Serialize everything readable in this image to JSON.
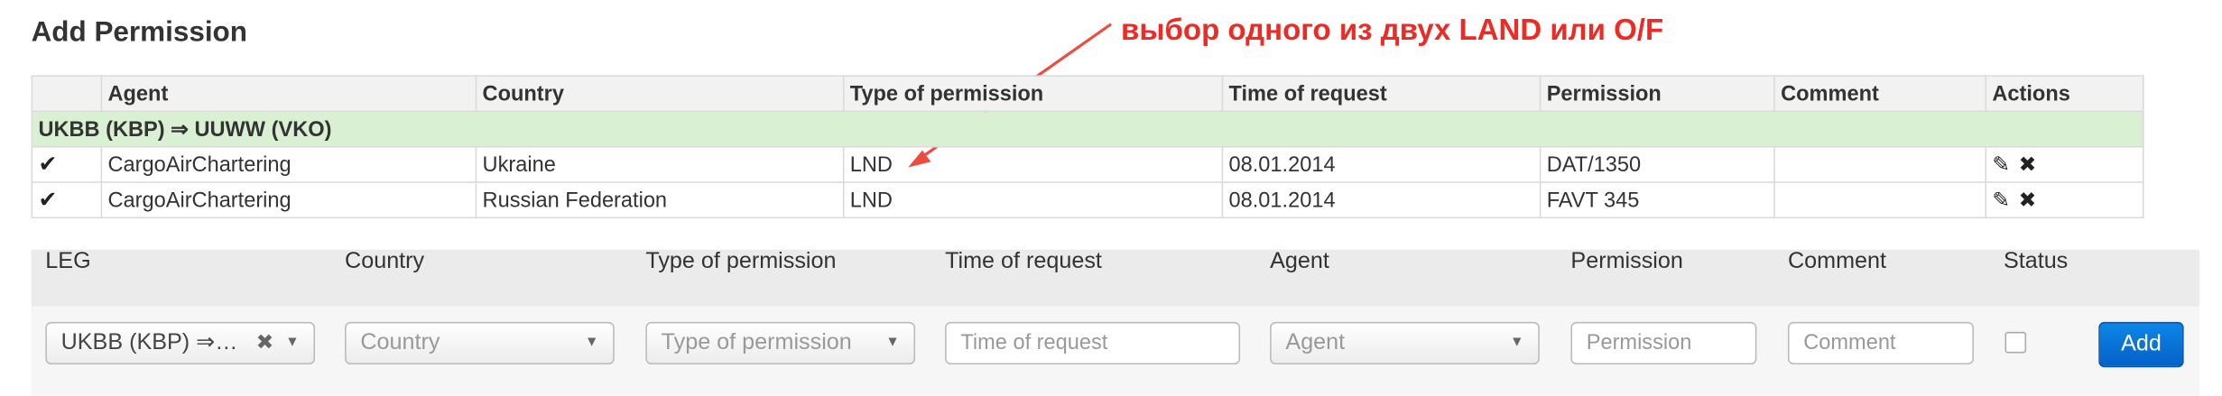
{
  "page": {
    "title": "Add Permission"
  },
  "annotation": {
    "text": "выбор одного из двух LAND или O/F"
  },
  "table": {
    "columns": [
      "",
      "Agent",
      "Country",
      "Type of permission",
      "Time of request",
      "Permission",
      "Comment",
      "Actions"
    ],
    "group_label": "UKBB (KBP) ⇒ UUWW (VKO)",
    "rows": [
      {
        "status_icon": "✔",
        "agent": "CargoAirChartering",
        "country": "Ukraine",
        "type": "LND",
        "time": "08.01.2014",
        "permission": "DAT/1350",
        "comment": ""
      },
      {
        "status_icon": "✔",
        "agent": "CargoAirChartering",
        "country": "Russian Federation",
        "type": "LND",
        "time": "08.01.2014",
        "permission": "FAVT 345",
        "comment": ""
      }
    ],
    "actions": {
      "edit_icon": "edit-icon",
      "delete_icon": "delete-icon"
    }
  },
  "form": {
    "headers": {
      "leg": "LEG",
      "country": "Country",
      "type": "Type of permission",
      "time": "Time of request",
      "agent": "Agent",
      "permission": "Permission",
      "comment": "Comment",
      "status": "Status"
    },
    "leg_value": "UKBB (KBP) ⇒…",
    "country_placeholder": "Country",
    "type_placeholder": "Type of permission",
    "time_placeholder": "Time of request",
    "agent_placeholder": "Agent",
    "permission_placeholder": "Permission",
    "comment_placeholder": "Comment",
    "add_label": "Add"
  },
  "colors": {
    "annotation": "#ee2a24",
    "group_row": "#d9f1d2",
    "add_button": "#0a74dc"
  }
}
